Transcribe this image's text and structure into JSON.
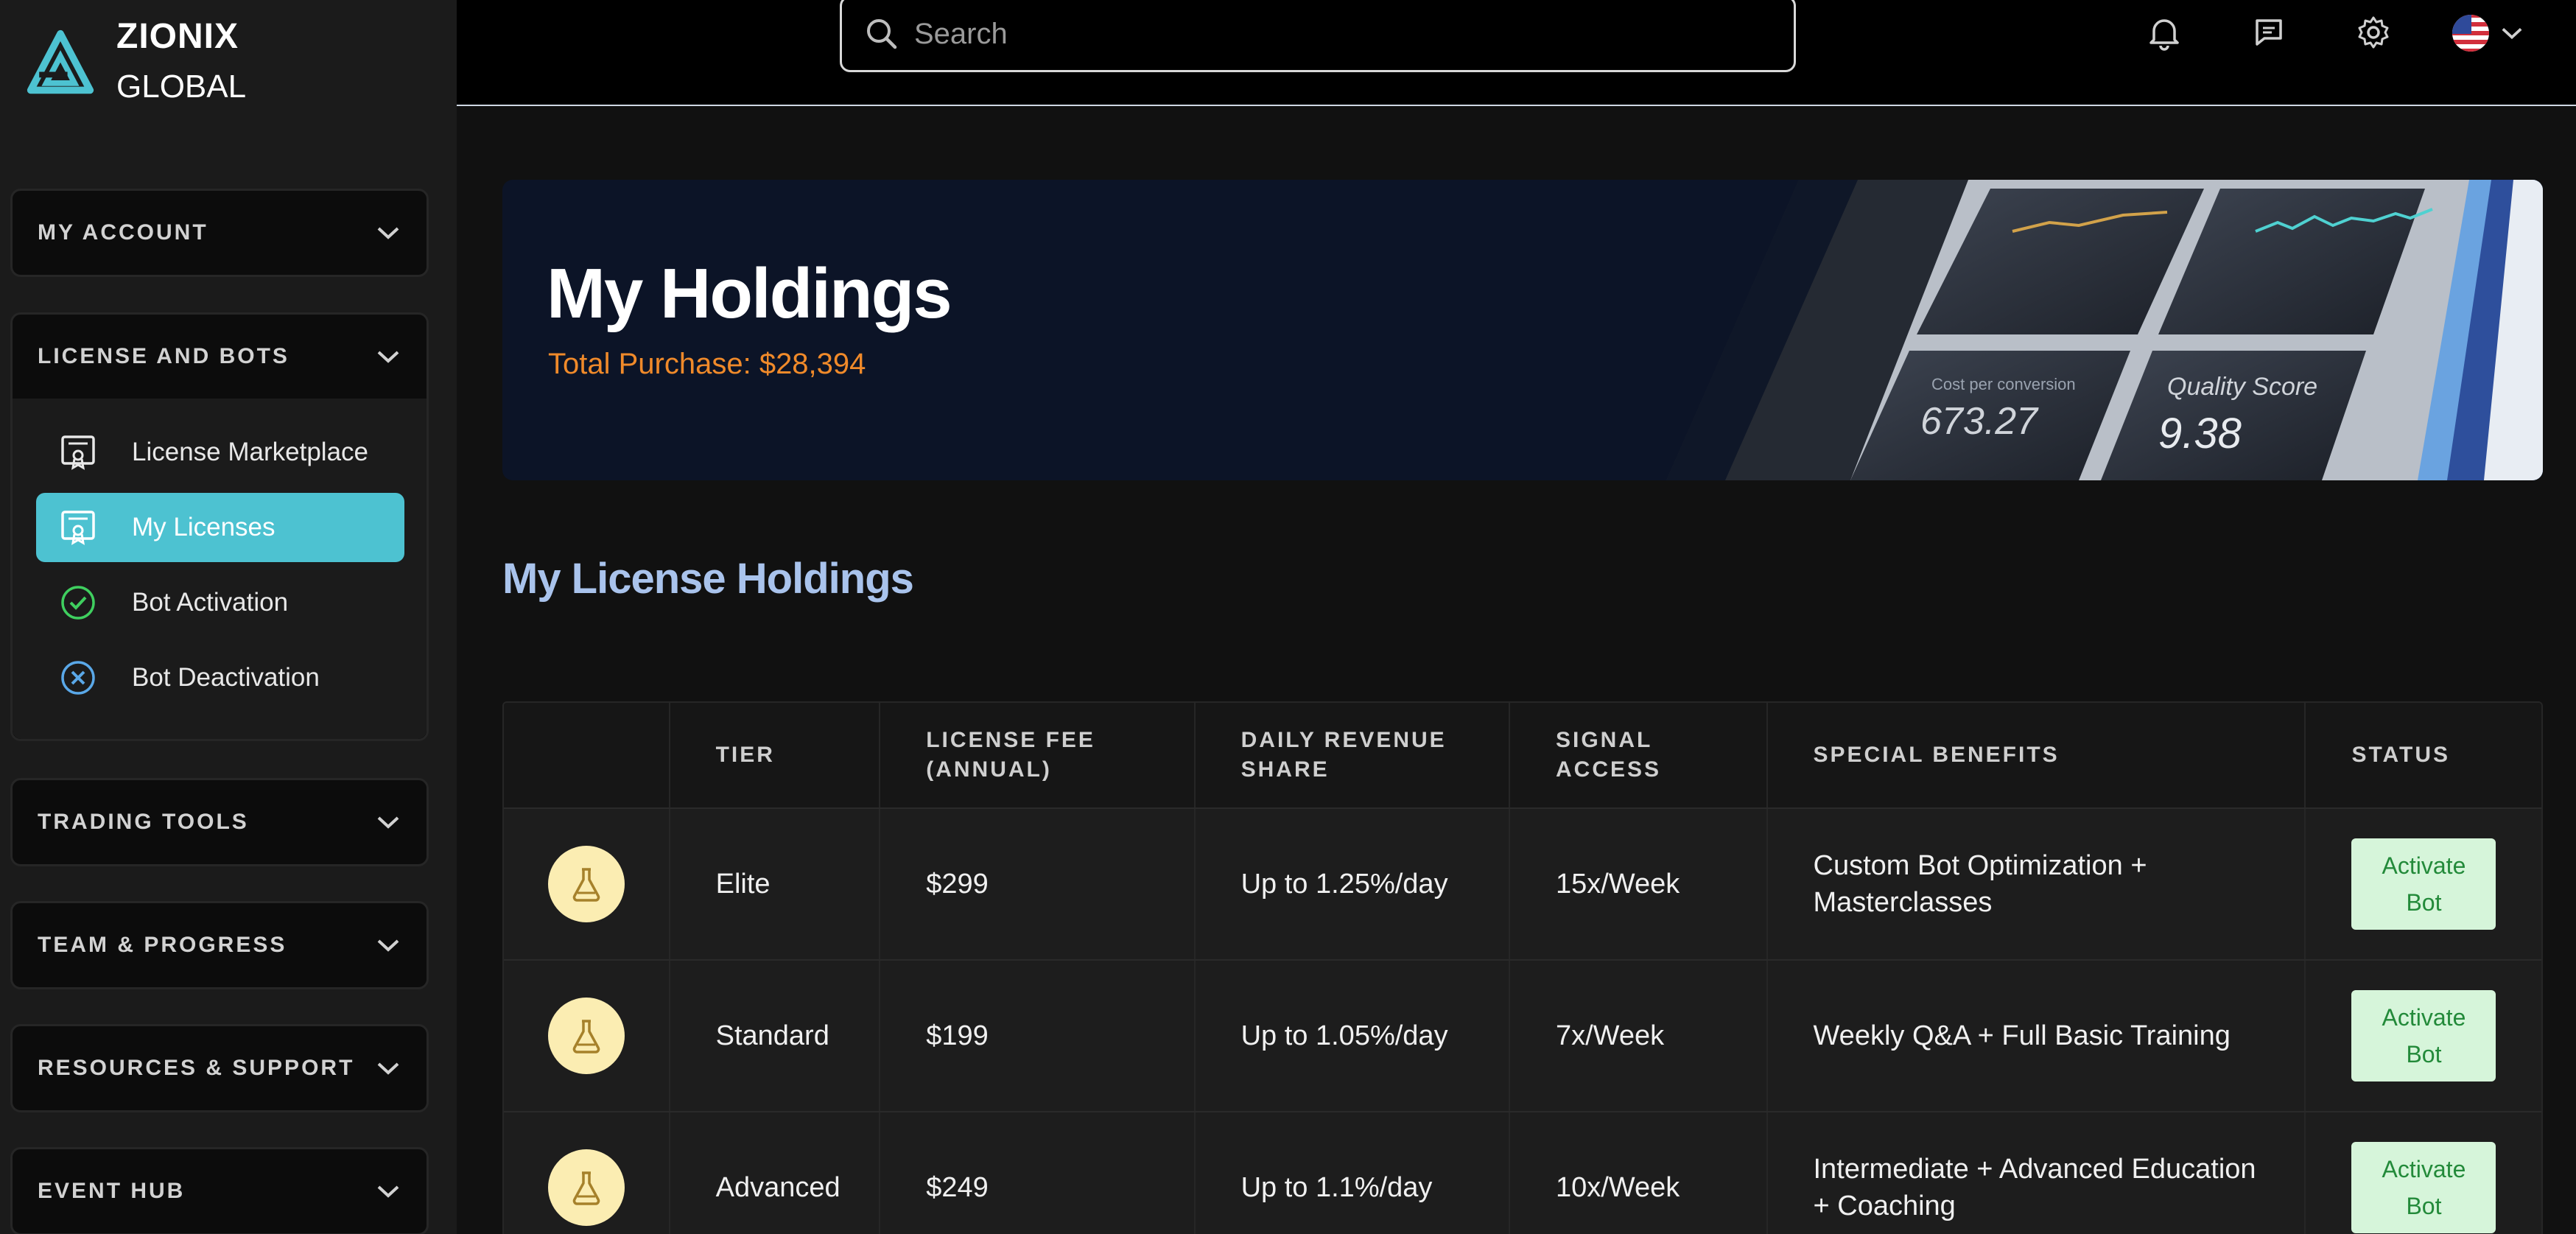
{
  "brand": {
    "name": "ZIONIX",
    "sub": "GLOBAL",
    "accent": "#4dc2d1"
  },
  "search": {
    "placeholder": "Search"
  },
  "sidebar": {
    "sections": [
      {
        "title": "MY ACCOUNT"
      },
      {
        "title": "LICENSE AND BOTS",
        "items": [
          {
            "label": "License Marketplace",
            "icon": "certificate-icon"
          },
          {
            "label": "My Licenses",
            "icon": "certificate-icon",
            "active": true
          },
          {
            "label": "Bot Activation",
            "icon": "check-circle-icon"
          },
          {
            "label": "Bot Deactivation",
            "icon": "x-circle-icon"
          }
        ]
      },
      {
        "title": "TRADING TOOLS"
      },
      {
        "title": "TEAM & PROGRESS"
      },
      {
        "title": "RESOURCES & SUPPORT"
      },
      {
        "title": "EVENT HUB"
      }
    ]
  },
  "banner": {
    "title": "My Holdings",
    "subtitle": "Total Purchase: $28,394",
    "art_text": {
      "label_a": "Cost per conversion",
      "value_a": "673.27",
      "label_b": "Quality Score",
      "value_b": "9.38"
    }
  },
  "holdings": {
    "heading": "My License Holdings",
    "columns": [
      "",
      "TIER",
      "LICENSE FEE\n(ANNUAL)",
      "DAILY REVENUE\nSHARE",
      "SIGNAL\nACCESS",
      "SPECIAL BENEFITS",
      "STATUS"
    ],
    "col_tier": "TIER",
    "col_fee_1": "LICENSE FEE",
    "col_fee_2": "(ANNUAL)",
    "col_rev_1": "DAILY REVENUE",
    "col_rev_2": "SHARE",
    "col_sig_1": "SIGNAL",
    "col_sig_2": "ACCESS",
    "col_benefits": "SPECIAL BENEFITS",
    "col_status": "STATUS",
    "rows": [
      {
        "tier": "Elite",
        "fee": "$299",
        "revenue": "Up to 1.25%/day",
        "signal": "15x/Week",
        "benefits": "Custom Bot Optimization + Masterclasses",
        "action_1": "Activate",
        "action_2": "Bot"
      },
      {
        "tier": "Standard",
        "fee": "$199",
        "revenue": "Up to 1.05%/day",
        "signal": "7x/Week",
        "benefits": "Weekly Q&A + Full Basic Training",
        "action_1": "Activate",
        "action_2": "Bot"
      },
      {
        "tier": "Advanced",
        "fee": "$249",
        "revenue": "Up to 1.1%/day",
        "signal": "10x/Week",
        "benefits": "Intermediate + Advanced Education + Coaching",
        "action_1": "Activate",
        "action_2": "Bot"
      }
    ]
  },
  "colors": {
    "accent": "#4dc2d1",
    "orange": "#f08a2a",
    "heading_blue": "#a9c3ec",
    "badge": "#fbedb2",
    "activate_bg": "#d6f5da",
    "activate_fg": "#238a3a"
  }
}
